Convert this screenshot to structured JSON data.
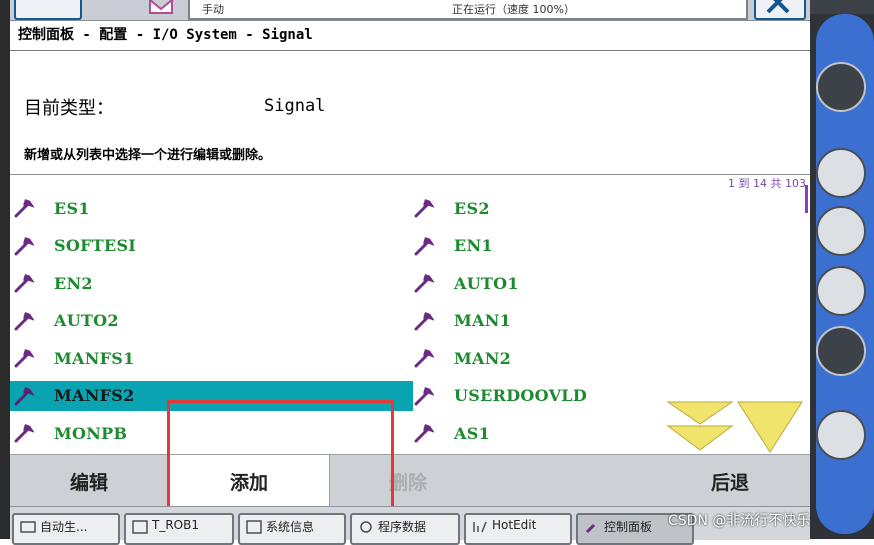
{
  "header": {
    "mode_text": "手动",
    "status_text": "正在运行（速度 100%）"
  },
  "breadcrumb": "控制面板 - 配置 - I/O System - Signal",
  "type_label": "目前类型：",
  "type_value": "Signal",
  "instruction": "新增或从列表中选择一个进行编辑或删除。",
  "paging": "1 到 14 共 103",
  "signals": [
    {
      "name": "ES1",
      "col": 0
    },
    {
      "name": "ES2",
      "col": 1
    },
    {
      "name": "SOFTESI",
      "col": 0
    },
    {
      "name": "EN1",
      "col": 1
    },
    {
      "name": "EN2",
      "col": 0
    },
    {
      "name": "AUTO1",
      "col": 1
    },
    {
      "name": "AUTO2",
      "col": 0
    },
    {
      "name": "MAN1",
      "col": 1
    },
    {
      "name": "MANFS1",
      "col": 0
    },
    {
      "name": "MAN2",
      "col": 1
    },
    {
      "name": "MANFS2",
      "col": 0,
      "selected": true
    },
    {
      "name": "USERDOOVLD",
      "col": 1
    },
    {
      "name": "MONPB",
      "col": 0
    },
    {
      "name": "AS1",
      "col": 1
    }
  ],
  "toolbar": {
    "edit": "编辑",
    "add": "添加",
    "delete": "删除",
    "back": "后退"
  },
  "taskbar": {
    "item1": "自动生...",
    "item2": "T_ROB1",
    "item3": "系统信息",
    "item4": "程序数据",
    "item5": "HotEdit",
    "item6": "控制面板"
  },
  "watermark": "CSDN @非流行不快乐",
  "colors": {
    "accent": "#0aa3b2",
    "signal_text": "#1c8a2e",
    "wrench": "#6b2a84",
    "highlight": "#e53935",
    "arrows": "#f1e46c"
  }
}
